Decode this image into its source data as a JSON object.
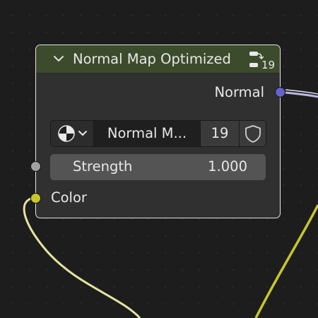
{
  "node": {
    "title": "Normal Map Optimized",
    "users_count": "19",
    "header_color": "#3c4b2b",
    "icons": {
      "collapse": "chevron-down-icon",
      "users": "node-group-users-icon"
    },
    "outputs": [
      {
        "label": "Normal",
        "socket_color": "#6363c7"
      }
    ],
    "datablock": {
      "type_icon": "node-tree-icon",
      "name": "Normal M...",
      "users": "19",
      "fake_user_icon": "shield-icon"
    },
    "inputs": [
      {
        "label": "Strength",
        "value": "1.000",
        "socket_color": "#a1a1a1"
      },
      {
        "label": "Color",
        "socket_color": "#c7c729"
      }
    ]
  }
}
